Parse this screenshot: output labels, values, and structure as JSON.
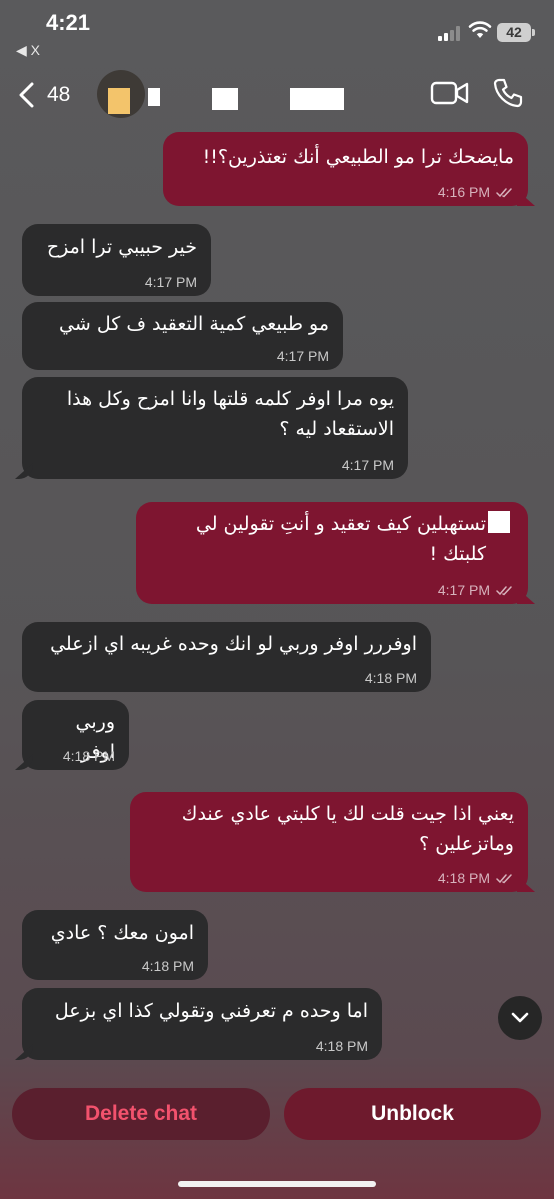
{
  "status_bar": {
    "time": "4:21",
    "back_app": "◀ X",
    "battery": "42"
  },
  "header": {
    "back_count": "48"
  },
  "messages": [
    {
      "dir": "out",
      "text": "مايضحك ترا مو الطبيعي أنك تعتذرين؟!!",
      "time": "4:16 PM",
      "read": true
    },
    {
      "dir": "in",
      "text": "خير حبيبي ترا امزح",
      "time": "4:17 PM"
    },
    {
      "dir": "in",
      "text": "مو طبيعي كمية التعقيد ف كل شي",
      "time": "4:17 PM"
    },
    {
      "dir": "in",
      "text": "يوه مرا اوفر كلمه قلتها وانا امزح وكل هذا الاستقعاد ليه ؟",
      "time": "4:17 PM"
    },
    {
      "dir": "out",
      "text": "تستهبلين كيف تعقيد و أنتِ تقولين لي كلبتك !",
      "time": "4:17 PM",
      "read": true
    },
    {
      "dir": "in",
      "text": "اوفررر اوفر وربي لو انك وحده غريبه اي ازعلي",
      "time": "4:18 PM"
    },
    {
      "dir": "in",
      "text": "وربي اوفر",
      "time": "4:18 PM"
    },
    {
      "dir": "out",
      "text": "يعني اذا جيت قلت لك يا كلبتي عادي عندك وماتزعلين ؟",
      "time": "4:18 PM",
      "read": true
    },
    {
      "dir": "in",
      "text": "امون معك ؟ عادي",
      "time": "4:18 PM"
    },
    {
      "dir": "in",
      "text": "اما وحده م تعرفني وتقولي كذا اي بزعل",
      "time": "4:18 PM"
    }
  ],
  "actions": {
    "delete_label": "Delete chat",
    "unblock_label": "Unblock"
  },
  "colors": {
    "outgoing_bubble": "#7e1530",
    "incoming_bubble": "#2b2b2c",
    "delete_text": "#f2526d"
  },
  "icons": [
    "back-chevron-icon",
    "video-call-icon",
    "phone-call-icon",
    "read-ticks-icon",
    "chevron-down-icon",
    "wifi-icon",
    "signal-icon"
  ]
}
